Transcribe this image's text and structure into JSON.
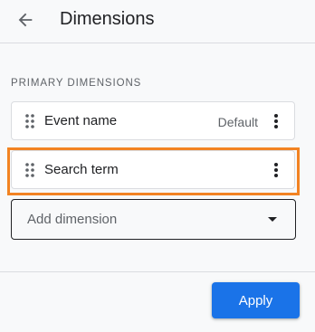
{
  "header": {
    "title": "Dimensions",
    "back_icon": "arrow-back-icon"
  },
  "section": {
    "label": "PRIMARY DIMENSIONS"
  },
  "dimensions": [
    {
      "name": "Event name",
      "default_label": "Default",
      "highlighted": false
    },
    {
      "name": "Search term",
      "default_label": "",
      "highlighted": true
    }
  ],
  "add_dimension": {
    "label": "Add dimension"
  },
  "footer": {
    "apply_label": "Apply"
  },
  "colors": {
    "accent": "#1a73e8",
    "highlight": "#f28322",
    "background": "#f8f9fa"
  }
}
